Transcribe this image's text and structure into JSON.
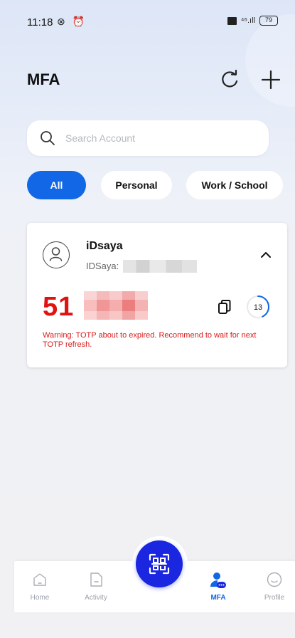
{
  "status_bar": {
    "time": "11:18",
    "left_icons": "⊗ ⏰",
    "signal": "⁴⁶.ıll",
    "battery": "79"
  },
  "header": {
    "title": "MFA",
    "refresh_icon": "refresh-icon",
    "add_icon": "plus-icon"
  },
  "search": {
    "placeholder": "Search Account",
    "value": ""
  },
  "filters": {
    "all": "All",
    "personal": "Personal",
    "work": "Work / School",
    "selected": "All"
  },
  "account": {
    "name": "iDsaya",
    "username_prefix": "IDSaya:",
    "otp_prefix": "51",
    "timer_seconds": "13",
    "timer_fraction": 0.43,
    "warning": "Warning: TOTP about to expired. Recommend to wait for next TOTP refresh."
  },
  "nav": {
    "home": "Home",
    "activity": "Activity",
    "mfa": "MFA",
    "profile": "Profile",
    "active": "MFA"
  },
  "colors": {
    "accent": "#1167e6",
    "fab": "#1a26e0",
    "otp": "#e11212",
    "warning": "#d81b1b"
  }
}
